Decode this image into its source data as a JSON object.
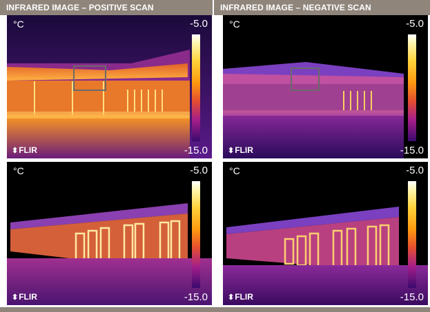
{
  "headers": {
    "left": "INFRARED IMAGE – POSITIVE SCAN",
    "right": "INFRARED IMAGE – NEGATIVE SCAN"
  },
  "panels": [
    {
      "unit": "°C",
      "max": "-5.0",
      "min": "-15.0",
      "logo": "FLIR"
    },
    {
      "unit": "°C",
      "max": "-5.0",
      "min": "-15.0",
      "logo": "FLIR"
    },
    {
      "unit": "°C",
      "max": "-5.0",
      "min": "-15.0",
      "logo": "FLIR"
    },
    {
      "unit": "°C",
      "max": "-5.0",
      "min": "-15.0",
      "logo": "FLIR"
    }
  ],
  "colors": {
    "header_bg": "#8f857b",
    "palette_hot": "#fff6b0",
    "palette_mid": "#ff9a10",
    "palette_cool": "#a51e8a",
    "palette_cold": "#1a0540"
  }
}
